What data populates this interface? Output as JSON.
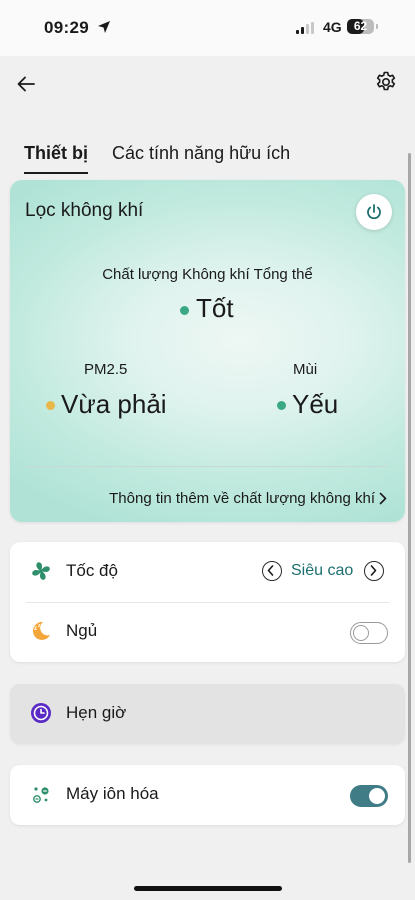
{
  "status_bar": {
    "time": "09:29",
    "network": "4G",
    "battery": "62",
    "battery_level": 0.62
  },
  "nav": {
    "back_icon": "arrow-left-icon",
    "settings_icon": "gear-icon"
  },
  "tabs": {
    "devices": "Thiết bị",
    "features": "Các tính năng hữu ích",
    "active": "devices"
  },
  "air_card": {
    "title": "Lọc không khí",
    "power_icon": "power-icon",
    "overall_label": "Chất lượng Không khí Tổng thể",
    "overall_value": "Tốt",
    "pm_label": "PM2.5",
    "pm_value": "Vừa phải",
    "odor_label": "Mùi",
    "odor_value": "Yếu",
    "more_info": "Thông tin thêm về chất lượng không khí",
    "colors": {
      "good": "#3aa882",
      "moderate": "#e9b84a"
    }
  },
  "controls": {
    "speed_label": "Tốc độ",
    "speed_value": "Siêu cao",
    "sleep_label": "Ngủ",
    "sleep_on": false,
    "timer_label": "Hẹn giờ",
    "ionizer_label": "Máy iôn hóa",
    "ionizer_on": true
  },
  "colors": {
    "accent": "#1d6f70",
    "toggle_on": "#3f7c86",
    "fan_icon": "#2f8f6b",
    "sleep_icon": "#f3a73a",
    "timer_icon": "#5b2ac4"
  }
}
